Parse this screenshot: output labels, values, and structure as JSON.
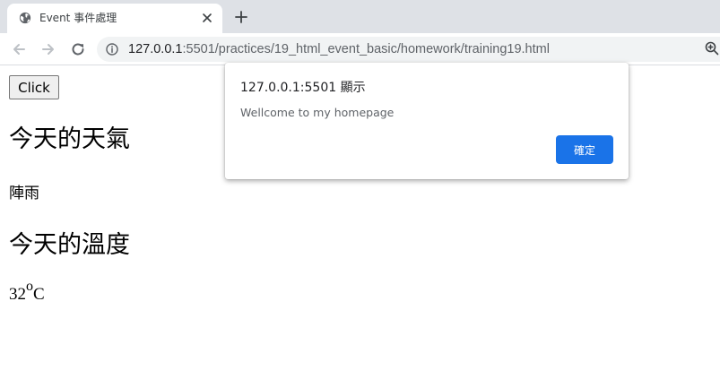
{
  "browser": {
    "tab": {
      "title": "Event 事件處理",
      "favicon": "globe-icon",
      "close_icon": "close-icon"
    },
    "new_tab_icon": "plus-icon",
    "toolbar": {
      "back_icon": "arrow-left-icon",
      "forward_icon": "arrow-right-icon",
      "reload_icon": "reload-icon",
      "site_info_icon": "info-icon",
      "url_host": "127.0.0.1",
      "url_rest": ":5501/practices/19_html_event_basic/homework/training19.html",
      "zoom_icon": "zoom-icon"
    }
  },
  "page": {
    "button_label": "Click",
    "heading_weather": "今天的天氣",
    "weather_value": "陣雨",
    "heading_temp": "今天的溫度",
    "temp_number": "32",
    "temp_degree": "o",
    "temp_unit": "C"
  },
  "dialog": {
    "title": "127.0.0.1:5501 顯示",
    "message": "Wellcome to my homepage",
    "ok_label": "確定",
    "ok_color": "#1a73e8"
  },
  "colors": {
    "tabstrip_bg": "#dee1e6",
    "omnibox_bg": "#f1f3f4",
    "text": "#202124",
    "secondary_text": "#5f6368"
  }
}
